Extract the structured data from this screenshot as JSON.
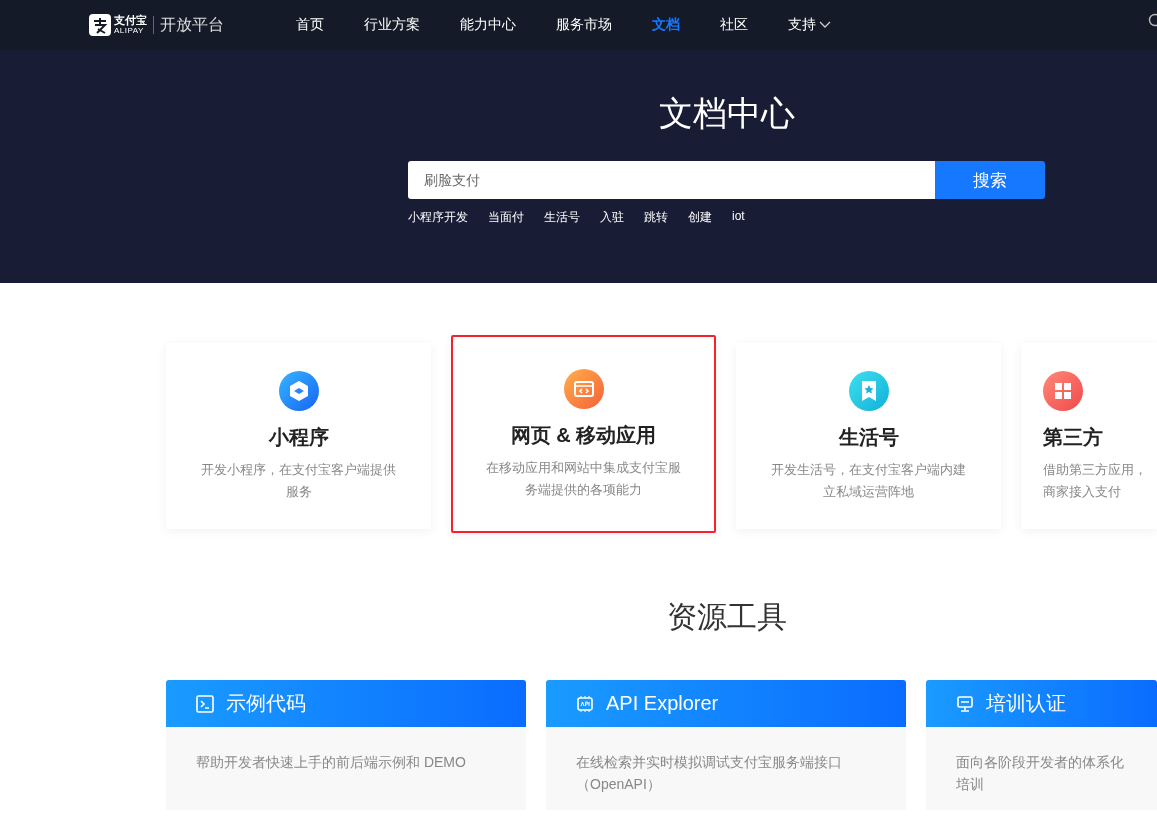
{
  "header": {
    "logo": {
      "brand": "支付宝",
      "brand_latin": "ALIPAY",
      "product": "开放平台"
    },
    "nav": [
      {
        "label": "首页",
        "selected": false
      },
      {
        "label": "行业方案",
        "selected": false
      },
      {
        "label": "能力中心",
        "selected": false
      },
      {
        "label": "服务市场",
        "selected": false
      },
      {
        "label": "文档",
        "selected": true
      },
      {
        "label": "社区",
        "selected": false
      },
      {
        "label": "支持",
        "selected": false,
        "dropdown": true
      }
    ]
  },
  "hero": {
    "title": "文档中心",
    "search": {
      "placeholder": "刷脸支付",
      "button": "搜索"
    },
    "hot_words": [
      "小程序开发",
      "当面付",
      "生活号",
      "入驻",
      "跳转",
      "创建",
      "iot"
    ]
  },
  "product_cards": [
    {
      "title": "小程序",
      "description": "开发小程序，在支付宝客户端提供服务",
      "highlighted": false
    },
    {
      "title": "网页 & 移动应用",
      "description": "在移动应用和网站中集成支付宝服务端提供的各项能力",
      "highlighted": true
    },
    {
      "title": "生活号",
      "description": "开发生活号，在支付宝客户端内建立私域运营阵地",
      "highlighted": false
    },
    {
      "title": "第三方",
      "description": "借助第三方应用，商家接入支付",
      "highlighted": false
    }
  ],
  "resources": {
    "title": "资源工具",
    "cards": [
      {
        "title": "示例代码",
        "description": "帮助开发者快速上手的前后端示例和 DEMO"
      },
      {
        "title": "API Explorer",
        "description": "在线检索并实时模拟调试支付宝服务端接口（OpenAPI）"
      },
      {
        "title": "培训认证",
        "description": "面向各阶段开发者的体系化培训"
      }
    ]
  }
}
